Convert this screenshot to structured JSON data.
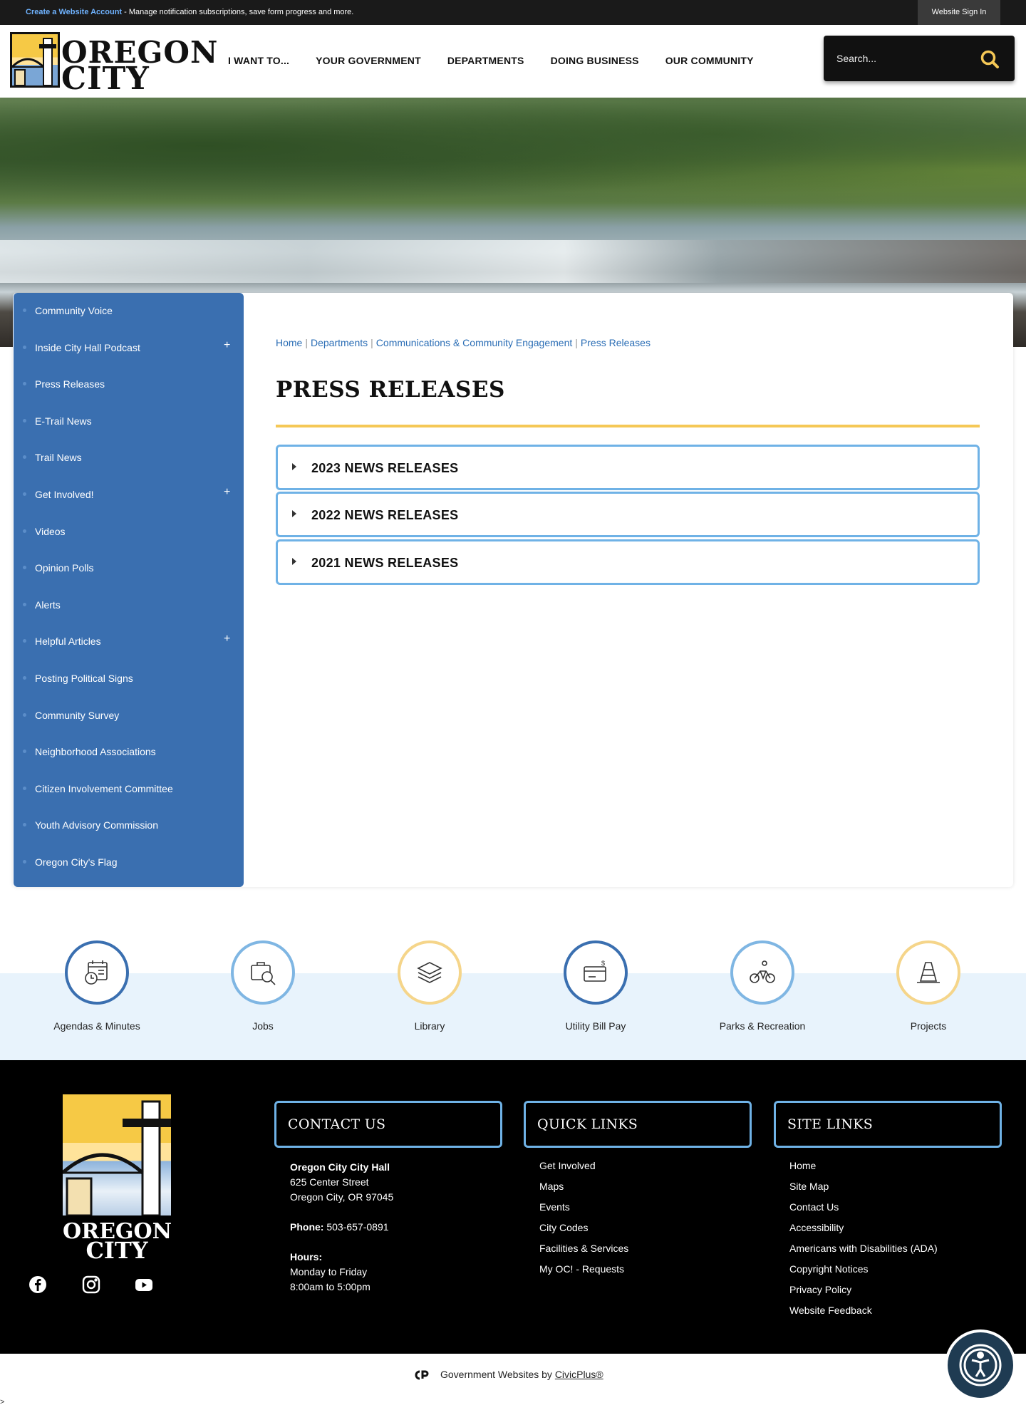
{
  "topbar": {
    "link": "Create a Website Account",
    "text": " - Manage notification subscriptions, save form progress and more.",
    "signin": "Website Sign In"
  },
  "header": {
    "logo_line1": "OREGON",
    "logo_line2": "CITY",
    "nav": [
      "I WANT TO...",
      "YOUR GOVERNMENT",
      "DEPARTMENTS",
      "DOING BUSINESS",
      "OUR COMMUNITY"
    ],
    "search_placeholder": "Search..."
  },
  "sidebar": {
    "items": [
      {
        "label": "Community Voice",
        "expandable": false
      },
      {
        "label": "Inside City Hall Podcast",
        "expandable": true
      },
      {
        "label": "Press Releases",
        "expandable": false
      },
      {
        "label": "E-Trail News",
        "expandable": false
      },
      {
        "label": "Trail News",
        "expandable": false
      },
      {
        "label": "Get Involved!",
        "expandable": true
      },
      {
        "label": "Videos",
        "expandable": false
      },
      {
        "label": "Opinion Polls",
        "expandable": false
      },
      {
        "label": "Alerts",
        "expandable": false
      },
      {
        "label": "Helpful Articles",
        "expandable": true
      },
      {
        "label": "Posting Political Signs",
        "expandable": false
      },
      {
        "label": "Community Survey",
        "expandable": false
      },
      {
        "label": "Neighborhood Associations",
        "expandable": false
      },
      {
        "label": "Citizen Involvement Committee",
        "expandable": false
      },
      {
        "label": "Youth Advisory Commission",
        "expandable": false
      },
      {
        "label": "Oregon City's Flag",
        "expandable": false
      }
    ],
    "plus": "+"
  },
  "main": {
    "breadcrumb": [
      "Home",
      "Departments",
      "Communications & Community Engagement",
      "Press Releases"
    ],
    "breadcrumb_sep": "|",
    "title": "PRESS RELEASES",
    "accordions": [
      "2023 NEWS RELEASES",
      "2022 NEWS RELEASES",
      "2021 NEWS RELEASES"
    ]
  },
  "quick_links": [
    {
      "label": "Agendas & Minutes",
      "icon": "calendar-clock-icon",
      "style": "dark"
    },
    {
      "label": "Jobs",
      "icon": "briefcase-search-icon",
      "style": "light"
    },
    {
      "label": "Library",
      "icon": "books-icon",
      "style": "gold"
    },
    {
      "label": "Utility Bill Pay",
      "icon": "wallet-card-icon",
      "style": "dark"
    },
    {
      "label": "Parks & Recreation",
      "icon": "cyclist-icon",
      "style": "light"
    },
    {
      "label": "Projects",
      "icon": "traffic-cone-icon",
      "style": "gold"
    }
  ],
  "footer": {
    "logo_line1": "OREGON",
    "logo_line2": "CITY",
    "contact_title": "CONTACT US",
    "quick_title": "QUICK LINKS",
    "site_title": "SITE LINKS",
    "contact": {
      "name": "Oregon City City Hall",
      "street": "625 Center Street",
      "city": "Oregon City, OR 97045",
      "phone_label": "Phone:",
      "phone": " 503-657-0891",
      "hours_label": "Hours:",
      "days": "Monday to Friday",
      "time": "8:00am to 5:00pm"
    },
    "quick_links": [
      "Get Involved",
      "Maps",
      "Events",
      "City Codes",
      "Facilities & Services",
      "My OC! - Requests"
    ],
    "site_links": [
      "Home",
      "Site Map",
      "Contact Us",
      "Accessibility",
      "Americans with Disabilities (ADA)",
      "Copyright Notices",
      "Privacy Policy",
      "Website Feedback"
    ]
  },
  "bottom": {
    "powered_text": "Government Websites by ",
    "powered_link": "CivicPlus®"
  },
  "caret": ">",
  "colors": {
    "sidebar": "#3a6fb0",
    "accent_gold": "#f5c856",
    "accordion_border": "#6fb2e6",
    "breadcrumb_link": "#2a6db5"
  }
}
